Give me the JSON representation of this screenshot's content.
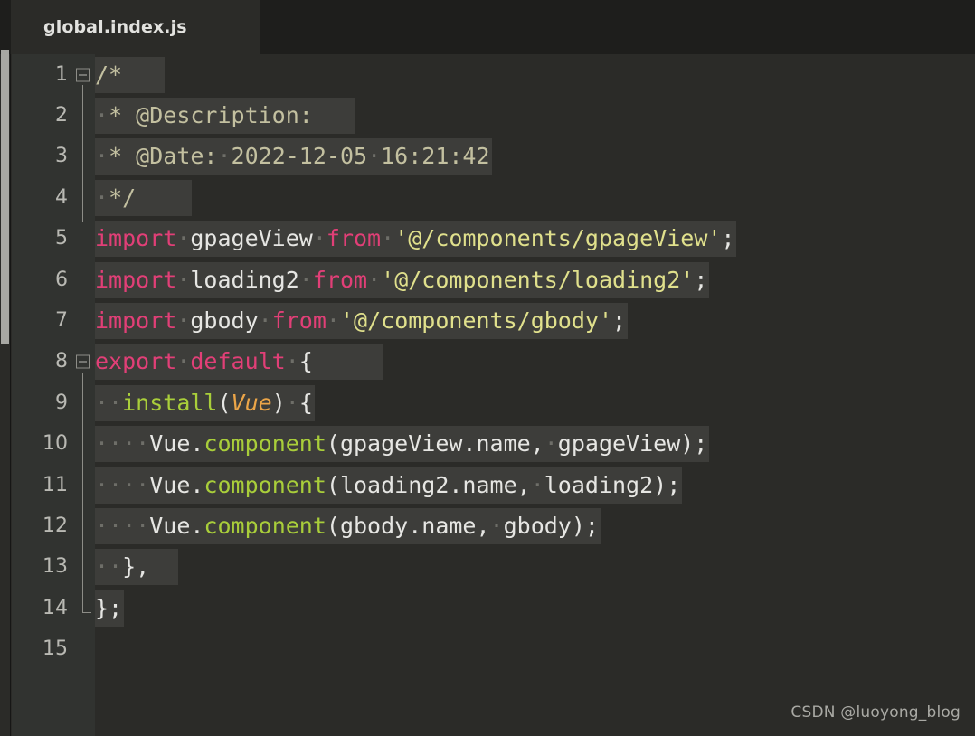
{
  "window": {
    "background_color": "#2b2b28",
    "chrome_color": "#1e1e1c"
  },
  "tabbar": {
    "active_tab_label": "global.index.js"
  },
  "theme": {
    "editor_background": "#2b2b28",
    "gutter_background": "#313330",
    "line_highlight": "#3d3d3a",
    "comment": "#c3c0a0",
    "keyword": "#e13f77",
    "plain": "#e6e6e3",
    "string": "#e0e08c",
    "function": "#a9ce3a",
    "parameter": "#eba548",
    "whitespace_dot": "#6e6e68",
    "line_number": "#b9b9b3"
  },
  "editor": {
    "line_numbers": [
      "1",
      "2",
      "3",
      "4",
      "5",
      "6",
      "7",
      "8",
      "9",
      "10",
      "11",
      "12",
      "13",
      "14",
      "15"
    ],
    "fold_markers": [
      1,
      8
    ],
    "lines": [
      {
        "n": "1",
        "text": "/*"
      },
      {
        "n": "2",
        "text": " * @Description:"
      },
      {
        "n": "3",
        "text": " * @Date: 2022-12-05 16:21:42"
      },
      {
        "n": "4",
        "text": " */"
      },
      {
        "n": "5",
        "text": "import gpageView from '@/components/gpageView';"
      },
      {
        "n": "6",
        "text": "import loading2 from '@/components/loading2';"
      },
      {
        "n": "7",
        "text": "import gbody from '@/components/gbody';"
      },
      {
        "n": "8",
        "text": "export default {"
      },
      {
        "n": "9",
        "text": "  install(Vue) {"
      },
      {
        "n": "10",
        "text": "    Vue.component(gpageView.name, gpageView);"
      },
      {
        "n": "11",
        "text": "    Vue.component(loading2.name, loading2);"
      },
      {
        "n": "12",
        "text": "    Vue.component(gbody.name, gbody);"
      },
      {
        "n": "13",
        "text": "  },"
      },
      {
        "n": "14",
        "text": "};"
      },
      {
        "n": "15",
        "text": ""
      }
    ],
    "tokens": {
      "l1": {
        "a": "/*"
      },
      "l2": {
        "dot": "·",
        "a": "* ",
        "b": "@Description:"
      },
      "l3": {
        "dot": "·",
        "a": "* ",
        "b": "@Date:",
        "c": "2022-12-05",
        "d": "16:21:42"
      },
      "l4": {
        "dot": "·",
        "a": "*/"
      },
      "l5": {
        "kw1": "import",
        "name": "gpageView",
        "kw2": "from",
        "str": "'@/components/gpageView'",
        "semi": ";"
      },
      "l6": {
        "kw1": "import",
        "name": "loading2",
        "kw2": "from",
        "str": "'@/components/loading2'",
        "semi": ";"
      },
      "l7": {
        "kw1": "import",
        "name": "gbody",
        "kw2": "from",
        "str": "'@/components/gbody'",
        "semi": ";"
      },
      "l8": {
        "kw1": "export",
        "kw2": "default",
        "brace": "{"
      },
      "l9": {
        "fn": "install",
        "paren1": "(",
        "param": "Vue",
        "paren2": ")",
        "brace": "{"
      },
      "l10": {
        "obj": "Vue.",
        "fn": "component",
        "args": "(gpageView.name,",
        "arg2": "gpageView);"
      },
      "l11": {
        "obj": "Vue.",
        "fn": "component",
        "args": "(loading2.name,",
        "arg2": "loading2);"
      },
      "l12": {
        "obj": "Vue.",
        "fn": "component",
        "args": "(gbody.name,",
        "arg2": "gbody);"
      },
      "l13": {
        "a": "},"
      },
      "l14": {
        "a": "};"
      }
    }
  },
  "watermark": {
    "text": "CSDN @luoyong_blog"
  }
}
